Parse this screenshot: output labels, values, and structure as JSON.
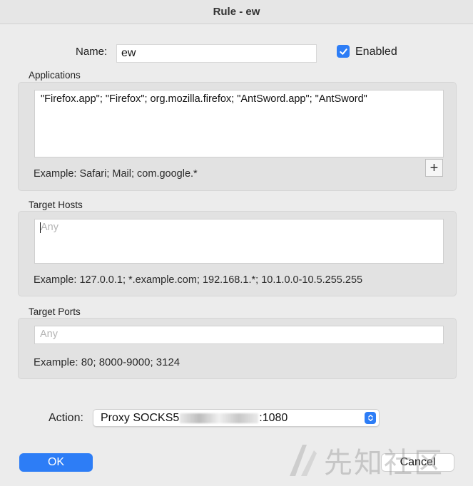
{
  "window": {
    "title": "Rule - ew"
  },
  "name": {
    "label": "Name:",
    "value": "ew"
  },
  "enabled": {
    "label": "Enabled",
    "checked": true
  },
  "applications": {
    "label": "Applications",
    "value": "\"Firefox.app\"; \"Firefox\"; org.mozilla.firefox; \"AntSword.app\"; \"AntSword\"",
    "example": "Example: Safari; Mail; com.google.*",
    "add_label": "+"
  },
  "target_hosts": {
    "label": "Target Hosts",
    "placeholder": "Any",
    "example": "Example: 127.0.0.1; *.example.com; 192.168.1.*; 10.1.0.0-10.5.255.255"
  },
  "target_ports": {
    "label": "Target Ports",
    "placeholder": "Any",
    "example": "Example: 80; 8000-9000; 3124"
  },
  "action": {
    "label": "Action:",
    "value_prefix": "Proxy SOCKS5",
    "value_suffix": ":1080"
  },
  "buttons": {
    "ok": "OK",
    "cancel": "Cancel"
  },
  "watermark": {
    "text": "先知社区"
  },
  "colors": {
    "accent": "#2d7df6",
    "background": "#ececec"
  }
}
